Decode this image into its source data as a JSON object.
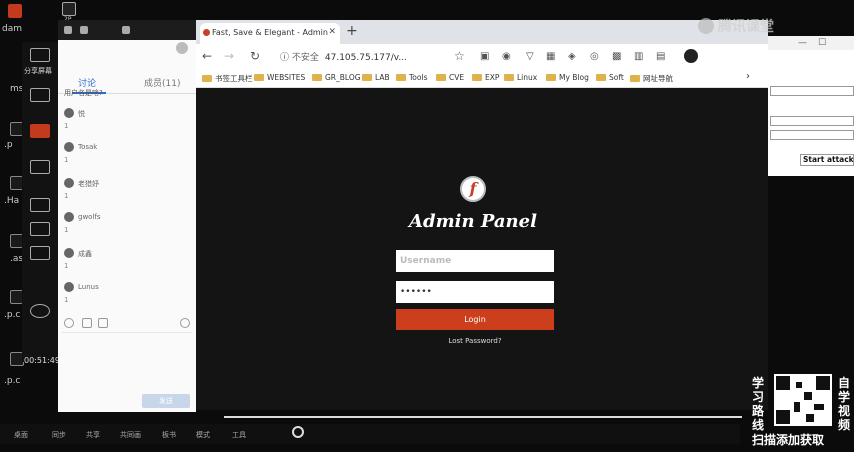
{
  "desktop": {
    "icons": [
      "dan",
      "ms",
      ".p",
      ".Ha",
      ".as",
      ".p.c",
      ".p.c"
    ],
    "top_items": [
      "dam",
      "2P"
    ],
    "clock": "00:51:49",
    "strip_labels": [
      "分享屏幕"
    ]
  },
  "chat": {
    "tabs": [
      {
        "label": "讨论"
      },
      {
        "label": "成员(11)"
      }
    ],
    "question": "用户名是啥?",
    "messages": [
      {
        "name": "悦",
        "count": "1"
      },
      {
        "name": "Tosak",
        "count": "1"
      },
      {
        "name": "老猎妤",
        "count": "1"
      },
      {
        "name": "gwolfs",
        "count": "1"
      },
      {
        "name": "成鑫",
        "count": "1"
      },
      {
        "name": "Lunus",
        "count": "1"
      }
    ],
    "send_label": "发送"
  },
  "browser": {
    "tab_title": "Fast, Save & Elegant - Admin Fo",
    "address_warning": "不安全",
    "address": "47.105.75.177/v...",
    "bookmarks": [
      "书签工具栏",
      "WEBSITES",
      "GR_BLOG",
      "LAB",
      "Tools",
      "CVE",
      "EXP",
      "Linux",
      "My Blog",
      "Soft",
      "网址导航"
    ]
  },
  "login": {
    "logo_letter": "f",
    "title": "Admin Panel",
    "username_placeholder": "Username",
    "password_value": "••••••",
    "login_label": "Login",
    "lost_password": "Lost Password?"
  },
  "side_window": {
    "start_button": "Start attack"
  },
  "watermark": {
    "text": "腾讯课堂"
  },
  "qr": {
    "left_chars": [
      "学",
      "习",
      "路",
      "线"
    ],
    "right_chars": [
      "自",
      "学",
      "视",
      "频"
    ],
    "caption": "扫描添加获取"
  },
  "taskbar": {
    "items": [
      "桌面",
      "同步",
      "共享",
      "共同画",
      "板书",
      "模式",
      "工具"
    ]
  }
}
